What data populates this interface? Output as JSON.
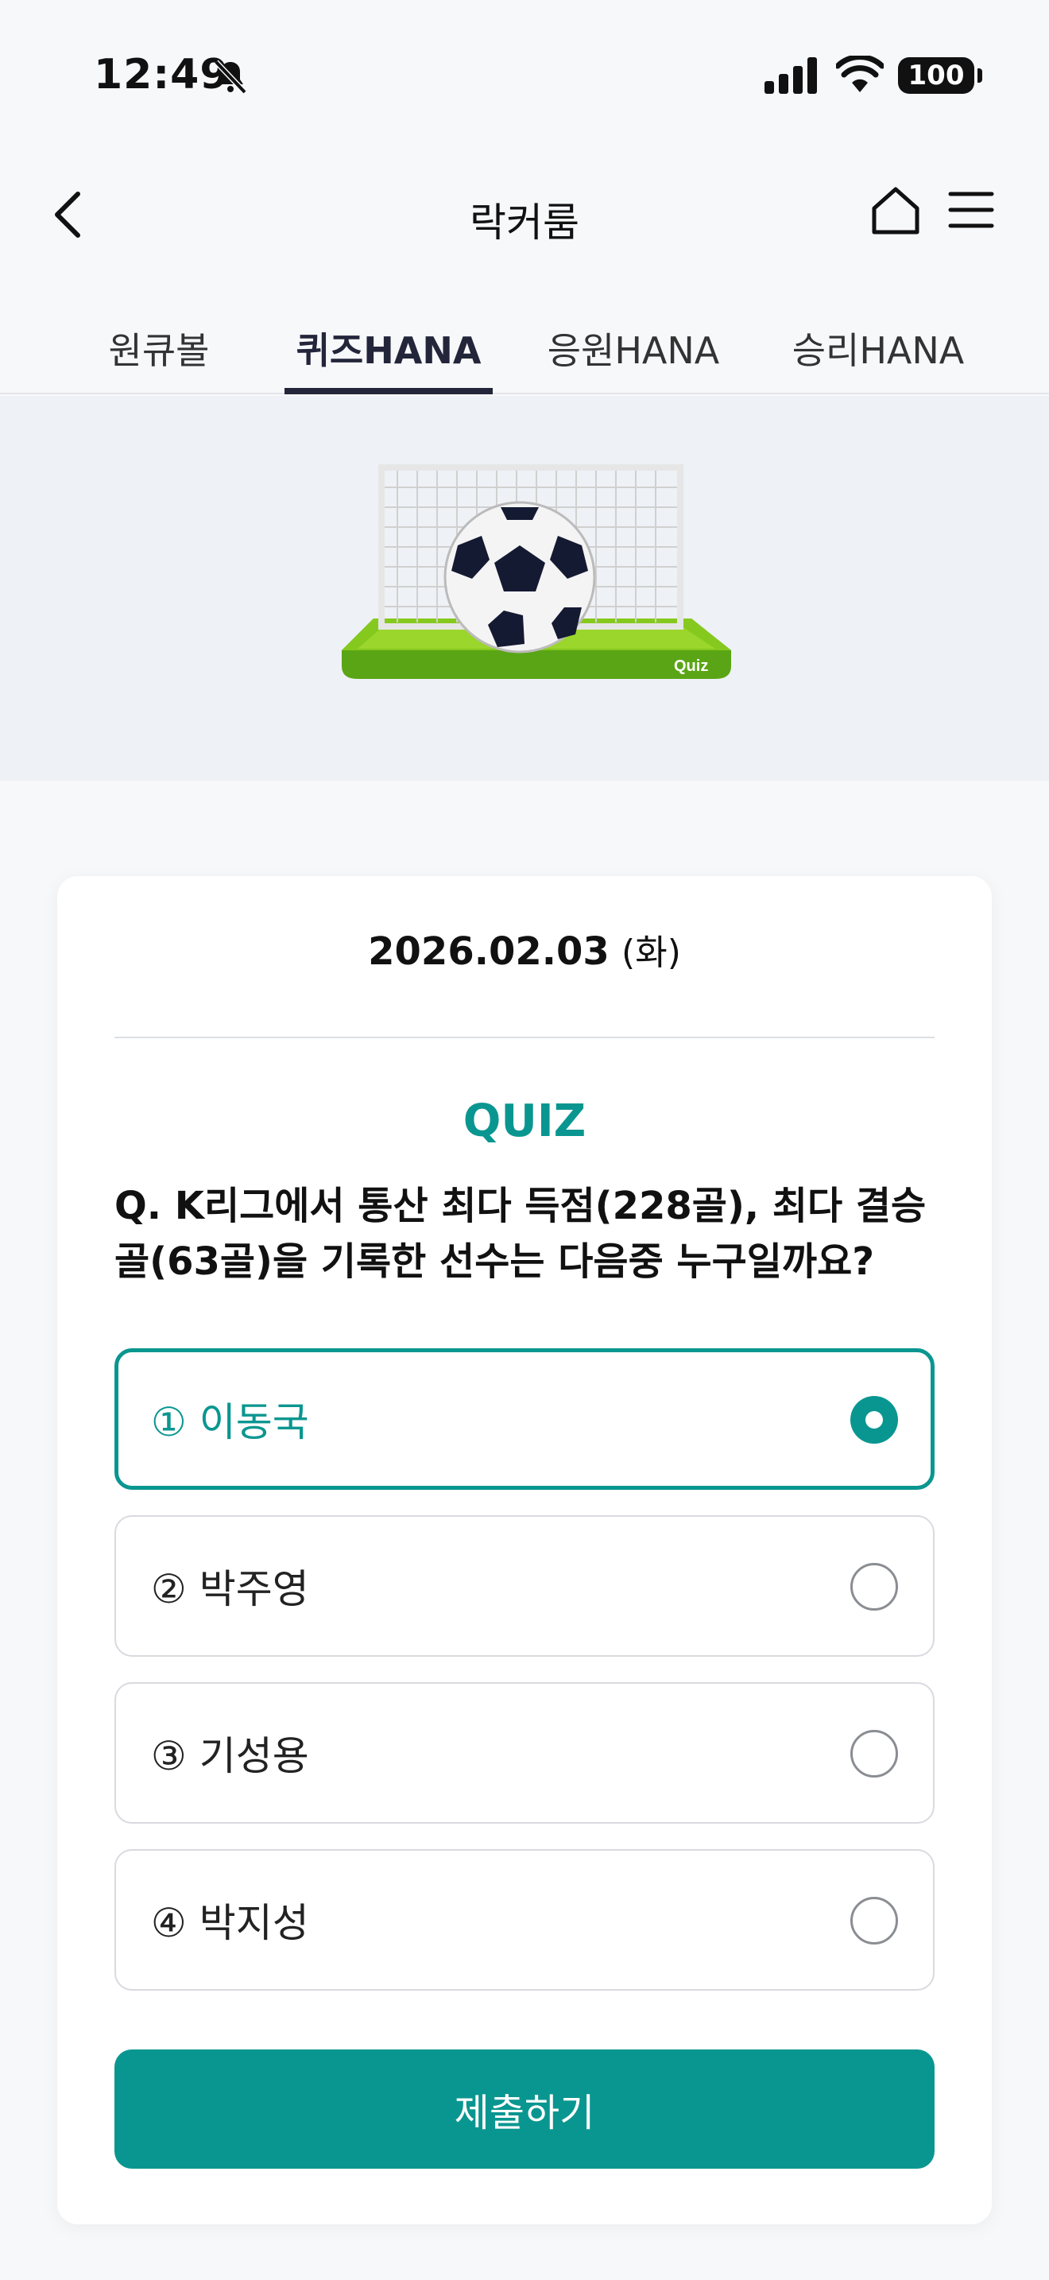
{
  "status_bar": {
    "time": "12:49",
    "battery": "100",
    "icons": [
      "bell-slash-icon",
      "signal-icon",
      "wifi-icon",
      "battery-icon"
    ]
  },
  "header": {
    "title": "락커룸",
    "icons": [
      "back-chevron-icon",
      "home-icon",
      "menu-icon"
    ]
  },
  "tabs": [
    {
      "label": "원큐볼",
      "active": false
    },
    {
      "label": "퀴즈HANA",
      "active": true
    },
    {
      "label": "응원HANA",
      "active": false
    },
    {
      "label": "승리HANA",
      "active": false
    }
  ],
  "banner": {
    "badge_text": "Quiz"
  },
  "quiz": {
    "date": "2026.02.03",
    "weekday": "(화)",
    "label": "QUIZ",
    "question": "Q. K리그에서 통산 최다 득점(228골), 최다 결승골(63골)을 기록한 선수는 다음중 누구일까요?",
    "options": [
      {
        "label": "① 이동국",
        "selected": true
      },
      {
        "label": "② 박주영",
        "selected": false
      },
      {
        "label": "③ 기성용",
        "selected": false
      },
      {
        "label": "④ 박지성",
        "selected": false
      }
    ],
    "submit_label": "제출하기"
  },
  "colors": {
    "accent": "#0a9690",
    "tab_active": "#23253a",
    "background": "#f7f8fa",
    "banner_bg": "#eef1f5"
  }
}
